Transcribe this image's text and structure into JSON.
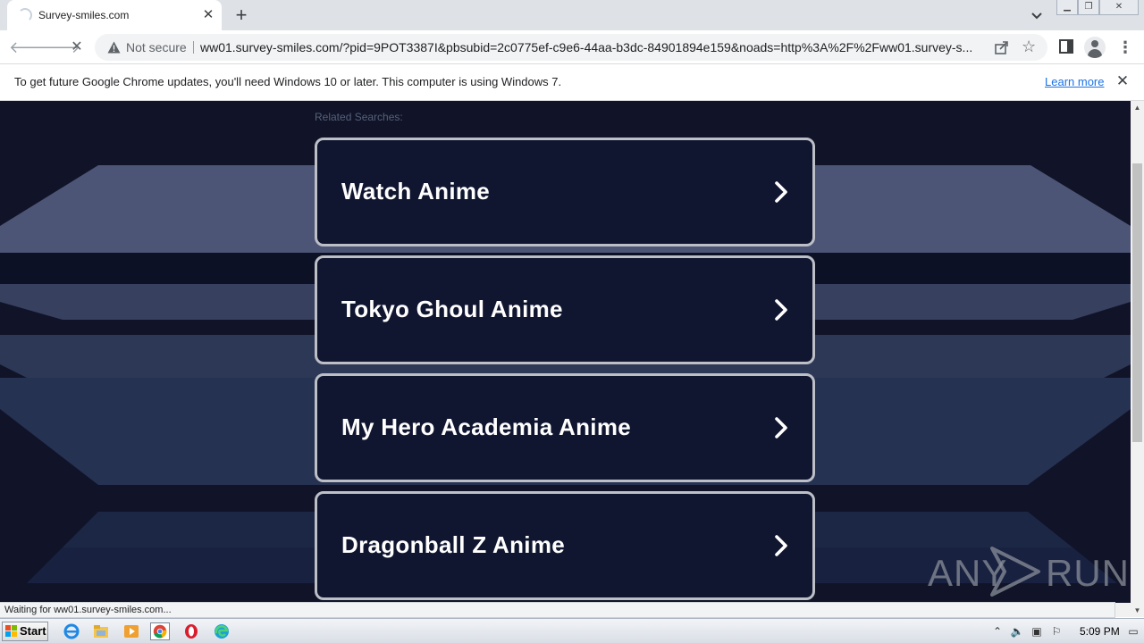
{
  "browser": {
    "tab_title": "Survey-smiles.com",
    "new_tab_label": "+",
    "address": {
      "security_label": "Not secure",
      "url": "ww01.survey-smiles.com/?pid=9POT3387I&pbsubid=2c0775ef-c9e6-44aa-b3dc-84901894e159&noads=http%3A%2F%2Fww01.survey-s..."
    },
    "infobar": {
      "message": "To get future Google Chrome updates, you'll need Windows 10 or later. This computer is using Windows 7.",
      "link": "Learn more"
    },
    "status_text": "Waiting for ww01.survey-smiles.com..."
  },
  "page": {
    "related_label": "Related Searches:",
    "results": [
      {
        "label": "Watch Anime"
      },
      {
        "label": "Tokyo Ghoul Anime"
      },
      {
        "label": "My Hero Academia Anime"
      },
      {
        "label": "Dragonball Z Anime"
      }
    ],
    "watermark": {
      "left": "ANY",
      "right": "RUN"
    }
  },
  "taskbar": {
    "start_label": "Start",
    "clock": "5:09 PM"
  },
  "colors": {
    "page_background": "#111428",
    "card_border": "#bdbfc7",
    "link_blue": "#1a73e8"
  },
  "icons": [
    "warning-icon",
    "share-icon",
    "star-icon",
    "chevron-right-icon",
    "windows-flag-icon",
    "ie-icon",
    "explorer-icon",
    "media-player-icon",
    "chrome-icon",
    "opera-icon",
    "edge-icon"
  ]
}
